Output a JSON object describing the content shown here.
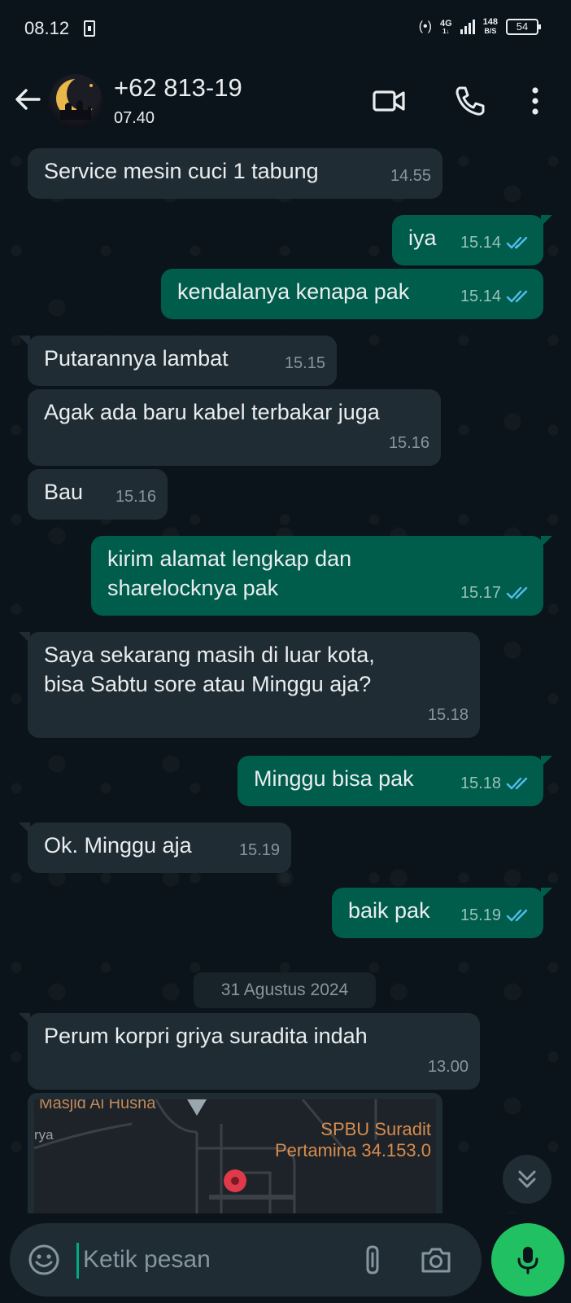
{
  "status_bar": {
    "time": "08.12",
    "network": "4G",
    "network_sub": "1↓",
    "speed_value": "148",
    "speed_unit": "B/S",
    "battery": "54"
  },
  "header": {
    "contact_name": "+62 813-19",
    "contact_status": "07.40",
    "icons": [
      "back-arrow-icon",
      "video-call-icon",
      "voice-call-icon",
      "more-options-icon"
    ]
  },
  "messages": [
    {
      "dir": "in",
      "text": "Service mesin cuci 1 tabung",
      "time": "14.55"
    },
    {
      "dir": "out",
      "text": "iya",
      "time": "15.14",
      "read": true
    },
    {
      "dir": "out",
      "text": "kendalanya kenapa pak",
      "time": "15.14",
      "read": true
    },
    {
      "dir": "in",
      "text": "Putarannya lambat",
      "time": "15.15"
    },
    {
      "dir": "in",
      "text": "Agak ada baru kabel terbakar juga",
      "time": "15.16"
    },
    {
      "dir": "in",
      "text": "Bau",
      "time": "15.16"
    },
    {
      "dir": "out",
      "text": "kirim alamat lengkap dan\nsharelocknya pak",
      "time": "15.17",
      "read": true
    },
    {
      "dir": "in",
      "text": "Saya sekarang masih di luar kota,\nbisa Sabtu sore atau Minggu aja?",
      "time": "15.18"
    },
    {
      "dir": "out",
      "text": "Minggu bisa pak",
      "time": "15.18",
      "read": true
    },
    {
      "dir": "in",
      "text": "Ok. Minggu aja",
      "time": "15.19"
    },
    {
      "dir": "out",
      "text": "baik pak",
      "time": "15.19",
      "read": true
    },
    {
      "dir": "in",
      "text": "Perum korpri griya suradita indah",
      "time": "13.00"
    }
  ],
  "date_chip": "31 Agustus 2024",
  "map": {
    "label_top": "Masjid Al Husna",
    "label_left": "rya",
    "poi": "SPBU Suradit\nPertamina 34.153.0"
  },
  "composer": {
    "placeholder": "Ketik pesan"
  },
  "colors": {
    "background": "#0b141a",
    "incoming_bubble": "#202c33",
    "outgoing_bubble": "#005c4b",
    "read_tick": "#53bdeb",
    "mic_button": "#21c063"
  }
}
